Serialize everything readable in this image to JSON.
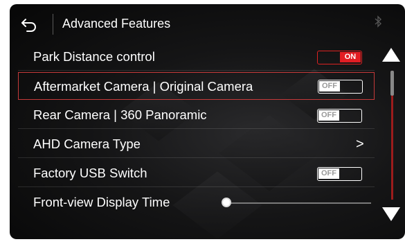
{
  "header": {
    "title": "Advanced Features"
  },
  "rows": [
    {
      "label": "Park Distance control",
      "control": "toggle",
      "state": "ON"
    },
    {
      "label": "Aftermarket Camera | Original Camera",
      "control": "toggle",
      "state": "OFF",
      "selected": true
    },
    {
      "label": "Rear Camera | 360 Panoramic",
      "control": "toggle",
      "state": "OFF"
    },
    {
      "label": "AHD Camera Type",
      "control": "chevron",
      "chevron": ">"
    },
    {
      "label": "Factory USB Switch",
      "control": "toggle",
      "state": "OFF"
    },
    {
      "label": "Front-view Display Time",
      "control": "slider",
      "value": 0
    }
  ],
  "colors": {
    "accent_red": "#e31e24",
    "text": "#ffffff",
    "background": "#111111"
  },
  "icons": [
    "back-icon",
    "bluetooth-icon",
    "scroll-up-icon",
    "scroll-down-icon",
    "chevron-right-icon"
  ]
}
